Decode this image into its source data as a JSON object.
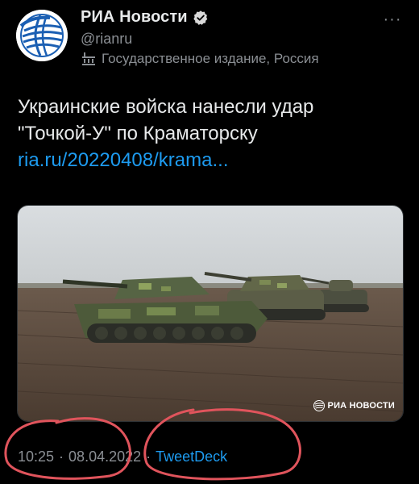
{
  "tweet": {
    "display_name": "РИА Новости",
    "handle": "@rianru",
    "label": "Государственное издание, Россия",
    "text_lines": [
      "Украинские войска нанесли удар",
      "\"Точкой-У\" по Краматорску"
    ],
    "link": "ria.ru/20220408/krama...",
    "time": "10:25",
    "date": "08.04.2022",
    "separator": "·",
    "source": "TweetDeck",
    "more_label": "···"
  },
  "media": {
    "watermark": "РИА НОВОСТИ"
  },
  "colors": {
    "background": "#000000",
    "text": "#e7e9ea",
    "secondary": "#8b8f94",
    "link": "#1d9bf0",
    "verified_badge": "#d9d9d9",
    "annotation": "#e0545c"
  },
  "icons": {
    "avatar": "ria-globe-logo",
    "verified": "verified-badge-icon",
    "label": "government-building-icon",
    "more": "more-options-icon"
  }
}
